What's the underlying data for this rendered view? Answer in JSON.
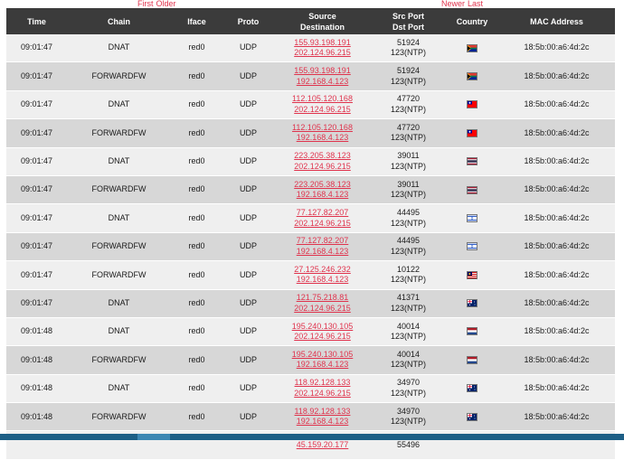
{
  "pager": {
    "first": "First",
    "older": "Older",
    "newer": "Newer",
    "last": "Last"
  },
  "columns": {
    "time": "Time",
    "chain": "Chain",
    "iface": "Iface",
    "proto": "Proto",
    "source": "Source",
    "destination": "Destination",
    "src_port": "Src Port",
    "dst_port": "Dst Port",
    "country": "Country",
    "mac": "MAC Address"
  },
  "flag_colors": {
    "za": [
      "#007a4d",
      "#ffb612",
      "#de3831",
      "#002395"
    ],
    "tw": [
      "#fe0000",
      "#000095"
    ],
    "th": [
      "#a51931",
      "#f4f5f8",
      "#2d2a4a"
    ],
    "il": [
      "#ffffff",
      "#0038b8"
    ],
    "my": [
      "#cc0001",
      "#010066",
      "#ffcc00"
    ],
    "au": [
      "#012169",
      "#e4002b"
    ],
    "nl": [
      "#ae1c28",
      "#ffffff",
      "#21468b"
    ]
  },
  "rows": [
    {
      "time": "09:01:47",
      "chain": "DNAT",
      "iface": "red0",
      "proto": "UDP",
      "src": "155.93.198.191",
      "dst": "202.124.96.215",
      "sport": "51924",
      "dport": "123(NTP)",
      "flag": "za",
      "mac": "18:5b:00:a6:4d:2c"
    },
    {
      "time": "09:01:47",
      "chain": "FORWARDFW",
      "iface": "red0",
      "proto": "UDP",
      "src": "155.93.198.191",
      "dst": "192.168.4.123",
      "sport": "51924",
      "dport": "123(NTP)",
      "flag": "za",
      "mac": "18:5b:00:a6:4d:2c"
    },
    {
      "time": "09:01:47",
      "chain": "DNAT",
      "iface": "red0",
      "proto": "UDP",
      "src": "112.105.120.168",
      "dst": "202.124.96.215",
      "sport": "47720",
      "dport": "123(NTP)",
      "flag": "tw",
      "mac": "18:5b:00:a6:4d:2c"
    },
    {
      "time": "09:01:47",
      "chain": "FORWARDFW",
      "iface": "red0",
      "proto": "UDP",
      "src": "112.105.120.168",
      "dst": "192.168.4.123",
      "sport": "47720",
      "dport": "123(NTP)",
      "flag": "tw",
      "mac": "18:5b:00:a6:4d:2c"
    },
    {
      "time": "09:01:47",
      "chain": "DNAT",
      "iface": "red0",
      "proto": "UDP",
      "src": "223.205.38.123",
      "dst": "202.124.96.215",
      "sport": "39011",
      "dport": "123(NTP)",
      "flag": "th",
      "mac": "18:5b:00:a6:4d:2c"
    },
    {
      "time": "09:01:47",
      "chain": "FORWARDFW",
      "iface": "red0",
      "proto": "UDP",
      "src": "223.205.38.123",
      "dst": "192.168.4.123",
      "sport": "39011",
      "dport": "123(NTP)",
      "flag": "th",
      "mac": "18:5b:00:a6:4d:2c"
    },
    {
      "time": "09:01:47",
      "chain": "DNAT",
      "iface": "red0",
      "proto": "UDP",
      "src": "77.127.82.207",
      "dst": "202.124.96.215",
      "sport": "44495",
      "dport": "123(NTP)",
      "flag": "il",
      "mac": "18:5b:00:a6:4d:2c"
    },
    {
      "time": "09:01:47",
      "chain": "FORWARDFW",
      "iface": "red0",
      "proto": "UDP",
      "src": "77.127.82.207",
      "dst": "192.168.4.123",
      "sport": "44495",
      "dport": "123(NTP)",
      "flag": "il",
      "mac": "18:5b:00:a6:4d:2c"
    },
    {
      "time": "09:01:47",
      "chain": "FORWARDFW",
      "iface": "red0",
      "proto": "UDP",
      "src": "27.125.246.232",
      "dst": "192.168.4.123",
      "sport": "10122",
      "dport": "123(NTP)",
      "flag": "my",
      "mac": "18:5b:00:a6:4d:2c"
    },
    {
      "time": "09:01:47",
      "chain": "DNAT",
      "iface": "red0",
      "proto": "UDP",
      "src": "121.75.218.81",
      "dst": "202.124.96.215",
      "sport": "41371",
      "dport": "123(NTP)",
      "flag": "au",
      "mac": "18:5b:00:a6:4d:2c"
    },
    {
      "time": "09:01:48",
      "chain": "DNAT",
      "iface": "red0",
      "proto": "UDP",
      "src": "195.240.130.105",
      "dst": "202.124.96.215",
      "sport": "40014",
      "dport": "123(NTP)",
      "flag": "nl",
      "mac": "18:5b:00:a6:4d:2c"
    },
    {
      "time": "09:01:48",
      "chain": "FORWARDFW",
      "iface": "red0",
      "proto": "UDP",
      "src": "195.240.130.105",
      "dst": "192.168.4.123",
      "sport": "40014",
      "dport": "123(NTP)",
      "flag": "nl",
      "mac": "18:5b:00:a6:4d:2c"
    },
    {
      "time": "09:01:48",
      "chain": "DNAT",
      "iface": "red0",
      "proto": "UDP",
      "src": "118.92.128.133",
      "dst": "202.124.96.215",
      "sport": "34970",
      "dport": "123(NTP)",
      "flag": "au",
      "mac": "18:5b:00:a6:4d:2c"
    },
    {
      "time": "09:01:48",
      "chain": "FORWARDFW",
      "iface": "red0",
      "proto": "UDP",
      "src": "118.92.128.133",
      "dst": "192.168.4.123",
      "sport": "34970",
      "dport": "123(NTP)",
      "flag": "au",
      "mac": "18:5b:00:a6:4d:2c"
    },
    {
      "time": "",
      "chain": "",
      "iface": "",
      "proto": "",
      "src": "45.159.20.177",
      "dst": "",
      "sport": "55496",
      "dport": "",
      "flag": "",
      "mac": ""
    }
  ]
}
